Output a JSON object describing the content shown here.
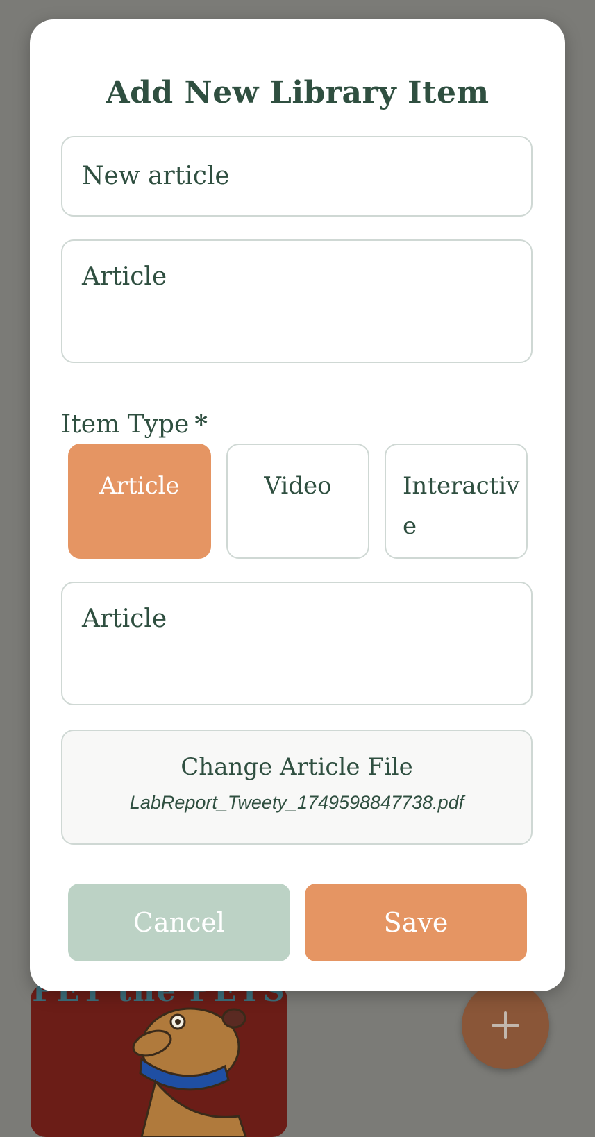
{
  "background": {
    "card_title": "PET the PETS",
    "fab_icon": "plus-icon"
  },
  "dialog": {
    "title": "Add New Library Item",
    "name_field": {
      "value": "New article"
    },
    "description_field": {
      "value": "Article"
    },
    "item_type": {
      "label": "Item Type",
      "required_marker": "*",
      "options": [
        {
          "label": "Article",
          "selected": true
        },
        {
          "label": "Video",
          "selected": false
        },
        {
          "label": "Interactive",
          "selected": false
        }
      ]
    },
    "content_field": {
      "value": "Article"
    },
    "file": {
      "button_label": "Change Article File",
      "filename": "LabReport_Tweety_1749598847738.pdf"
    },
    "actions": {
      "cancel_label": "Cancel",
      "save_label": "Save"
    }
  },
  "colors": {
    "accent": "#e59563",
    "secondary": "#bcd2c5",
    "text": "#2f4f40",
    "overlay": "#7b7b77"
  }
}
